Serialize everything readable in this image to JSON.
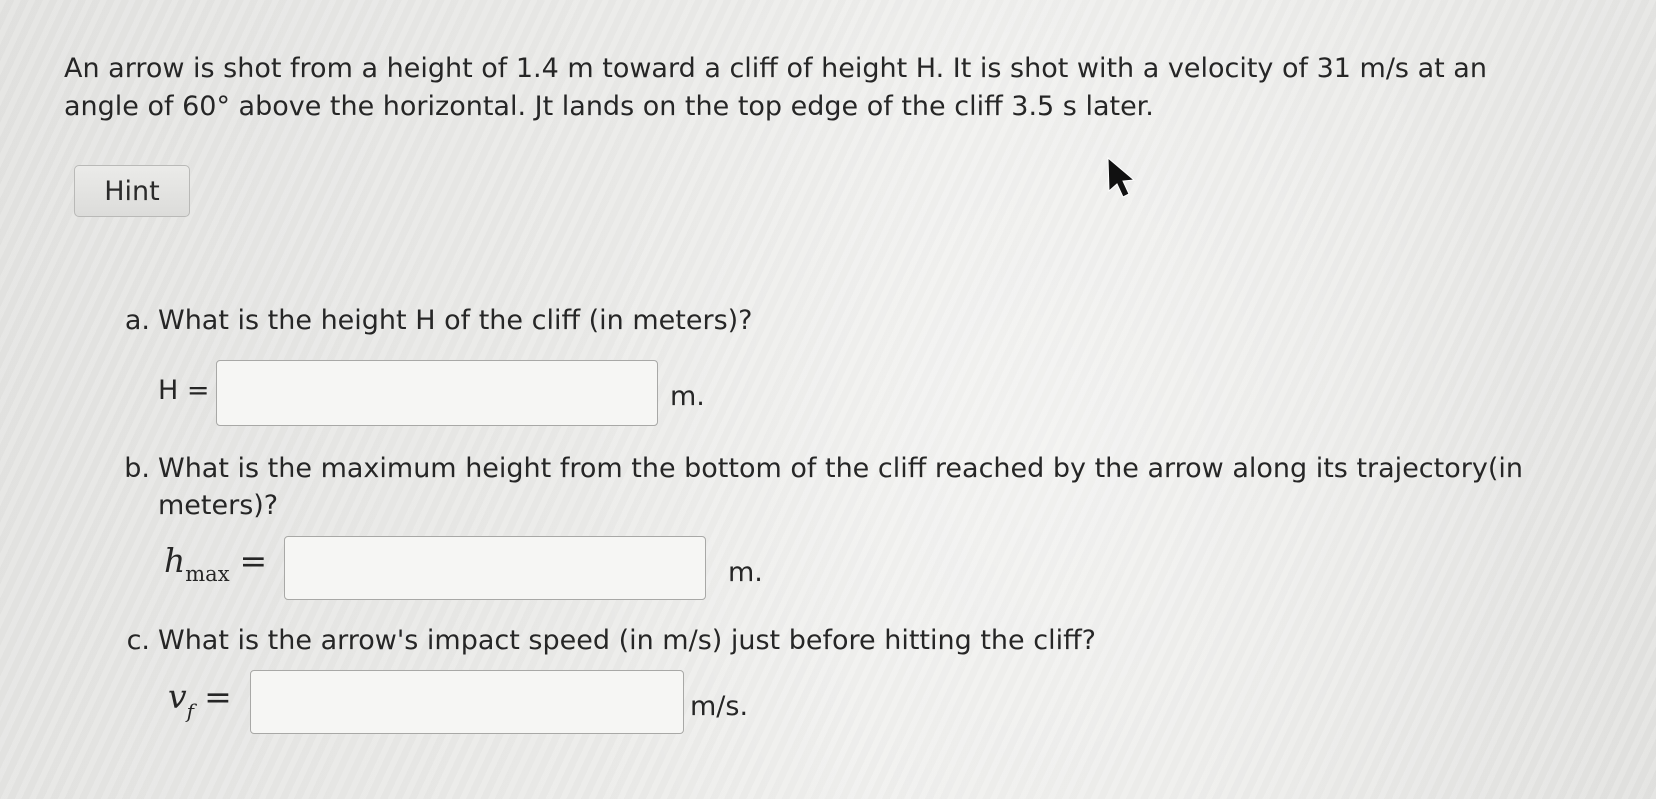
{
  "problem": {
    "line1": "An arrow is shot from a height of 1.4 m toward a cliff of height H. It is shot with a velocity of 31 m/s at an",
    "line2": "angle of 60° above the horizontal. Jt lands on the top edge of the cliff 3.5 s later."
  },
  "hint_label": "Hint",
  "questions": {
    "a": {
      "letter": "a.",
      "text": "What is the height H of the cliff (in meters)?",
      "label": "H =",
      "value": "",
      "unit": "m."
    },
    "b": {
      "letter": "b.",
      "text_line1": "What is the maximum height from the bottom of the cliff reached by the arrow along its trajectory(in",
      "text_line2": "meters)?",
      "var": "h",
      "sub": "max",
      "eq": "=",
      "value": "",
      "unit": "m."
    },
    "c": {
      "letter": "c.",
      "text": "What is the arrow's impact speed (in m/s) just before hitting the cliff?",
      "var": "v",
      "sub": "f",
      "eq": "=",
      "value": "",
      "unit": "m/s."
    }
  }
}
